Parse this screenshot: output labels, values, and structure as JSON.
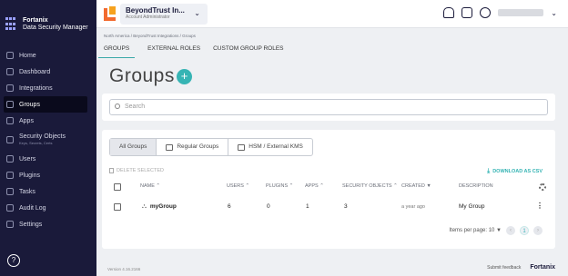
{
  "brand": {
    "name": "Fortanix",
    "product": "Data Security Manager"
  },
  "sidebar": {
    "items": [
      {
        "label": "Home",
        "icon": "home-icon"
      },
      {
        "label": "Dashboard",
        "icon": "dashboard-icon"
      },
      {
        "label": "Integrations",
        "icon": "integrations-icon"
      },
      {
        "label": "Groups",
        "icon": "groups-icon",
        "active": true
      },
      {
        "label": "Apps",
        "icon": "apps-icon"
      },
      {
        "label": "Security Objects",
        "sublabel": "Keys, Secrets, Certs",
        "icon": "key-icon"
      },
      {
        "label": "Users",
        "icon": "users-icon"
      },
      {
        "label": "Plugins",
        "icon": "plugins-icon"
      },
      {
        "label": "Tasks",
        "icon": "tasks-icon"
      },
      {
        "label": "Audit Log",
        "icon": "audit-log-icon"
      },
      {
        "label": "Settings",
        "icon": "settings-icon"
      }
    ]
  },
  "account": {
    "name": "BeyondTrust In...",
    "role": "Account Administrator"
  },
  "breadcrumb": "North America / BeyondTrust Integrations / Groups",
  "tabs": [
    "GROUPS",
    "EXTERNAL ROLES",
    "CUSTOM GROUP ROLES"
  ],
  "page": {
    "title": "Groups"
  },
  "search": {
    "placeholder": "Search"
  },
  "filters": [
    "All Groups",
    "Regular Groups",
    "HSM / External KMS"
  ],
  "actions": {
    "delete": "DELETE SELECTED",
    "download": "DOWNLOAD AS CSV"
  },
  "table": {
    "columns": {
      "name": "NAME ⌃",
      "users": "USERS ⌃",
      "plugins": "PLUGINS ⌃",
      "apps": "APPS ⌃",
      "security_objects": "SECURITY OBJECTS ⌃",
      "created": "CREATED ▼",
      "description": "DESCRIPTION"
    },
    "rows": [
      {
        "name": "myGroup",
        "users": "6",
        "plugins": "0",
        "apps": "1",
        "security_objects": "3",
        "created": "a year ago",
        "description": "My Group"
      }
    ]
  },
  "pagination": {
    "items_per_page_label": "Items per page: 10 ▼",
    "current_page": "1"
  },
  "footer": {
    "version": "Version 4.16.2166",
    "feedback": "Submit feedback",
    "logo": "Fortanix"
  },
  "colors": {
    "sidebar_bg": "#1a1a3a",
    "accent": "#36b4b4"
  }
}
